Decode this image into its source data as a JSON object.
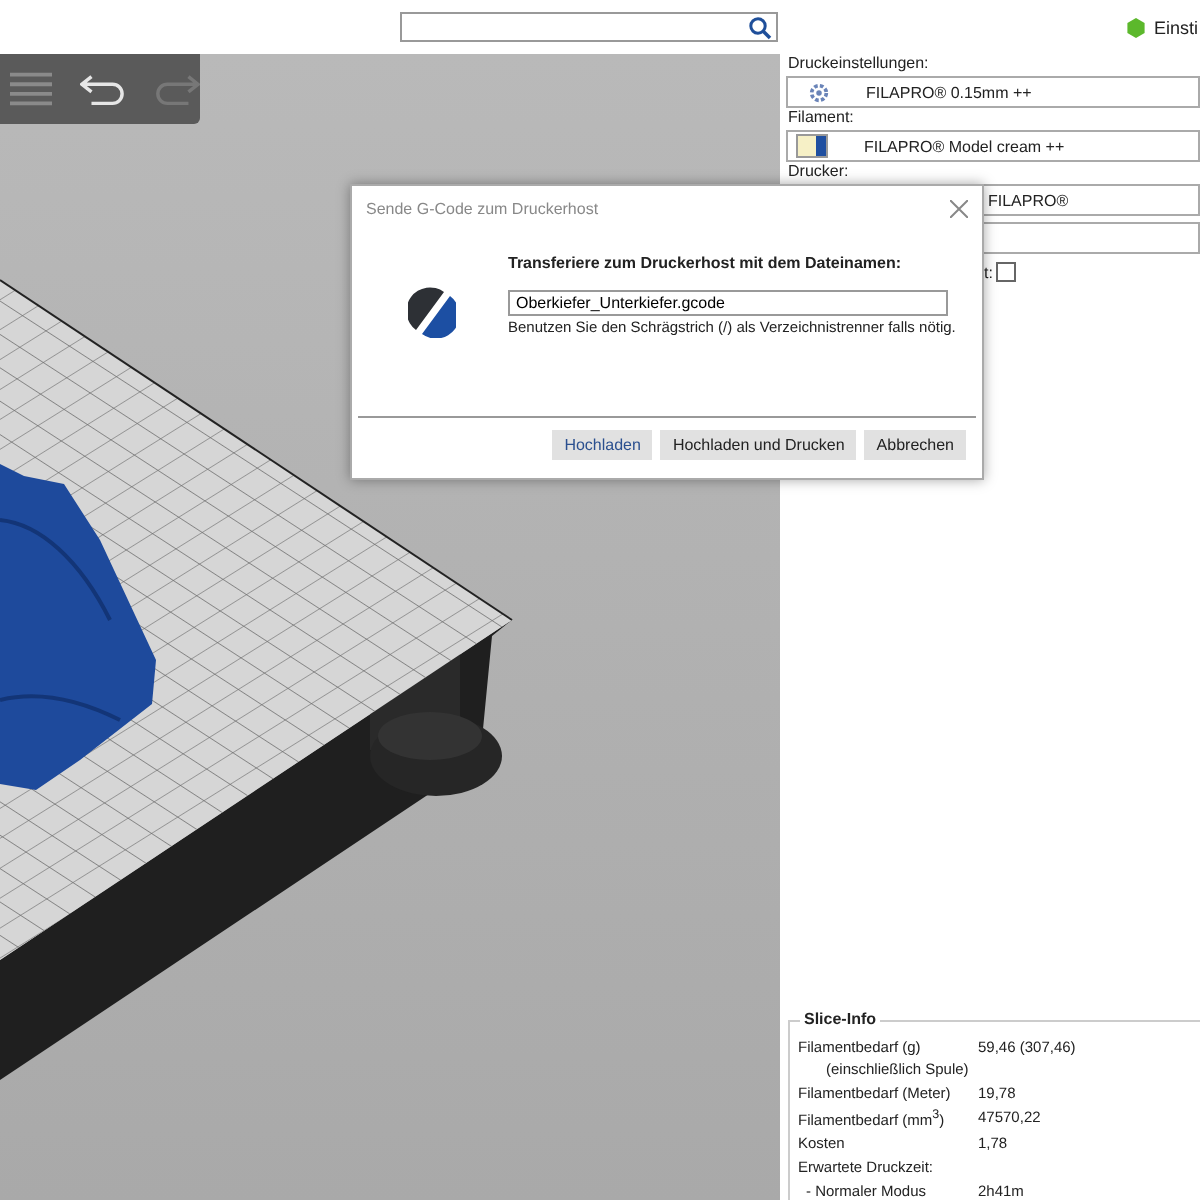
{
  "top_bar": {
    "status": {
      "label": "Einsti",
      "color": "#5cb82c"
    }
  },
  "toolbar": {
    "undo": {
      "disabled": false
    },
    "redo": {
      "disabled": true
    }
  },
  "settings_panel": {
    "fields": [
      {
        "kind": "profile",
        "label": "Druckeinstellungen:",
        "value": "FILAPRO® 0.15mm ++"
      },
      {
        "kind": "filament",
        "label": "Filament:",
        "value": "FILAPRO® Model cream ++",
        "color": "#f6f0c6"
      },
      {
        "kind": "printer",
        "label": "Drucker:",
        "value": "FILAPRO®"
      },
      {
        "kind": "blank"
      }
    ],
    "checkbox": {
      "label": "t:",
      "checked": false
    }
  },
  "dialog": {
    "title": "Sende G-Code zum Druckerhost",
    "heading": "Transferiere zum Druckerhost mit dem Dateinamen:",
    "filename": "Oberkiefer_Unterkiefer.gcode",
    "hint": "Benutzen Sie den Schrägstrich (/) als Verzeichnistrenner falls nötig.",
    "buttons": [
      {
        "label": "Hochladen",
        "default": true
      },
      {
        "label": "Hochladen und Drucken",
        "default": false
      },
      {
        "label": "Abbrechen",
        "default": false
      }
    ]
  },
  "slice_info": {
    "title": "Slice-Info",
    "rows": [
      {
        "label": "Filamentbedarf (g)",
        "sublabel": "(einschließlich Spule)",
        "value": "59,46 (307,46)",
        "indent": false
      },
      {
        "label": "Filamentbedarf (Meter)",
        "value": "19,78",
        "indent": false
      },
      {
        "label": "Filamentbedarf (mm$^{3}$)",
        "value": "47570,22",
        "indent": false
      },
      {
        "label": "Kosten",
        "value": "1,78",
        "indent": false
      },
      {
        "label": "Erwartete Druckzeit:",
        "indent": false
      },
      {
        "label": "- Normaler Modus",
        "value": "2h41m",
        "indent": true
      }
    ]
  }
}
